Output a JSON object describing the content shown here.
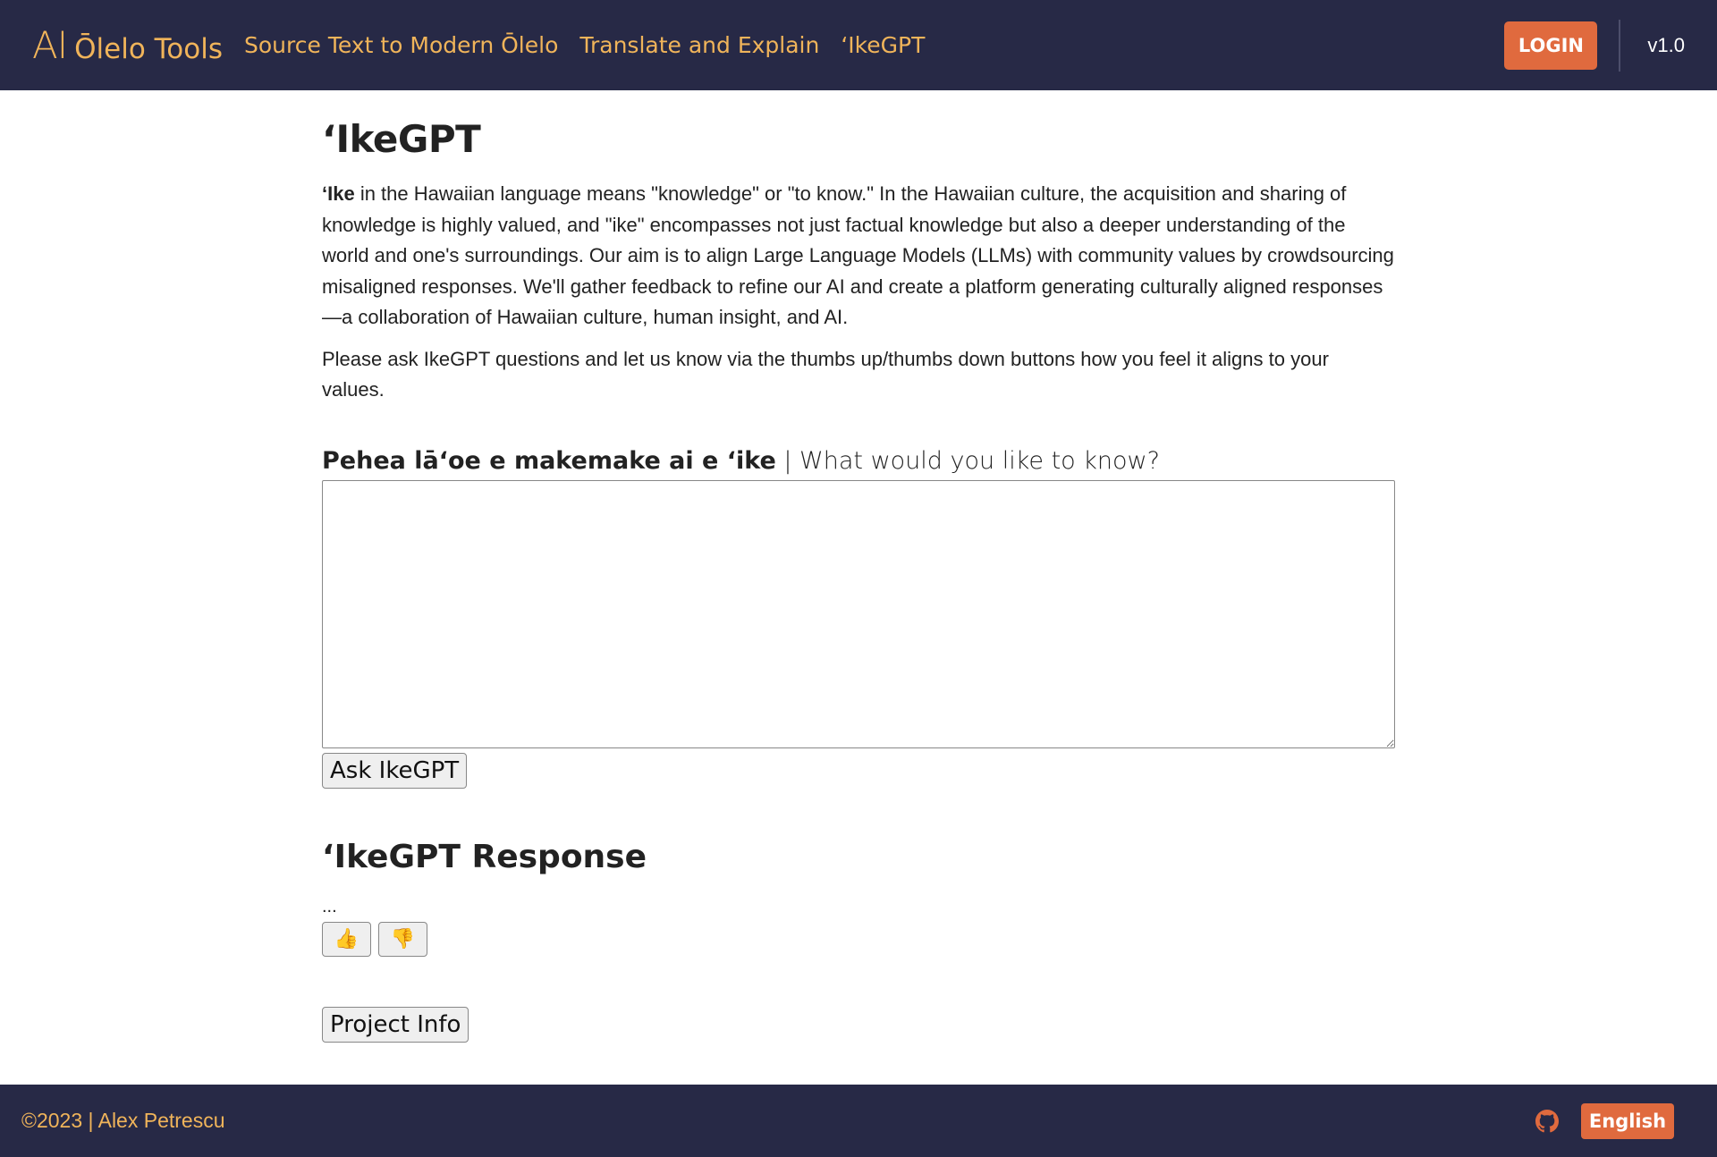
{
  "header": {
    "brand_ai": "AI",
    "brand_rest": "Ōlelo Tools",
    "nav": [
      {
        "label": "Source Text to Modern Ōlelo"
      },
      {
        "label": "Translate and Explain"
      },
      {
        "label": "ʻIkeGPT"
      }
    ],
    "login_label": "LOGIN",
    "version": "v1.0"
  },
  "main": {
    "title": "ʻIkeGPT",
    "intro_bold": "ʻIke",
    "intro_rest": " in the Hawaiian language means \"knowledge\" or \"to know.\" In the Hawaiian culture, the acquisition and sharing of knowledge is highly valued, and \"ike\" encompasses not just factual knowledge but also a deeper understanding of the world and one's surroundings. Our aim is to align Large Language Models (LLMs) with community values by crowdsourcing misaligned responses. We'll gather feedback to refine our AI and create a platform generating culturally aligned responses—a collaboration of Hawaiian culture, human insight, and AI.",
    "intro2": "Please ask IkeGPT questions and let us know via the thumbs up/thumbs down buttons how you feel it aligns to your values.",
    "question_label_hawaiian": "Pehea lāʻoe e makemake ai e ʻike",
    "question_label_english": " | What would you like to know?",
    "question_value": "",
    "ask_label": "Ask IkeGPT",
    "response_title": "ʻIkeGPT Response",
    "response_text": "...",
    "thumbs_up": "👍",
    "thumbs_down": "👎",
    "project_info_label": "Project Info"
  },
  "footer": {
    "copyright": "©2023 | Alex Petrescu",
    "github_icon": "github-icon",
    "language_label": "English"
  },
  "colors": {
    "nav_bg": "#272946",
    "accent_gold": "#f0b45a",
    "accent_orange": "#e06a3e"
  }
}
